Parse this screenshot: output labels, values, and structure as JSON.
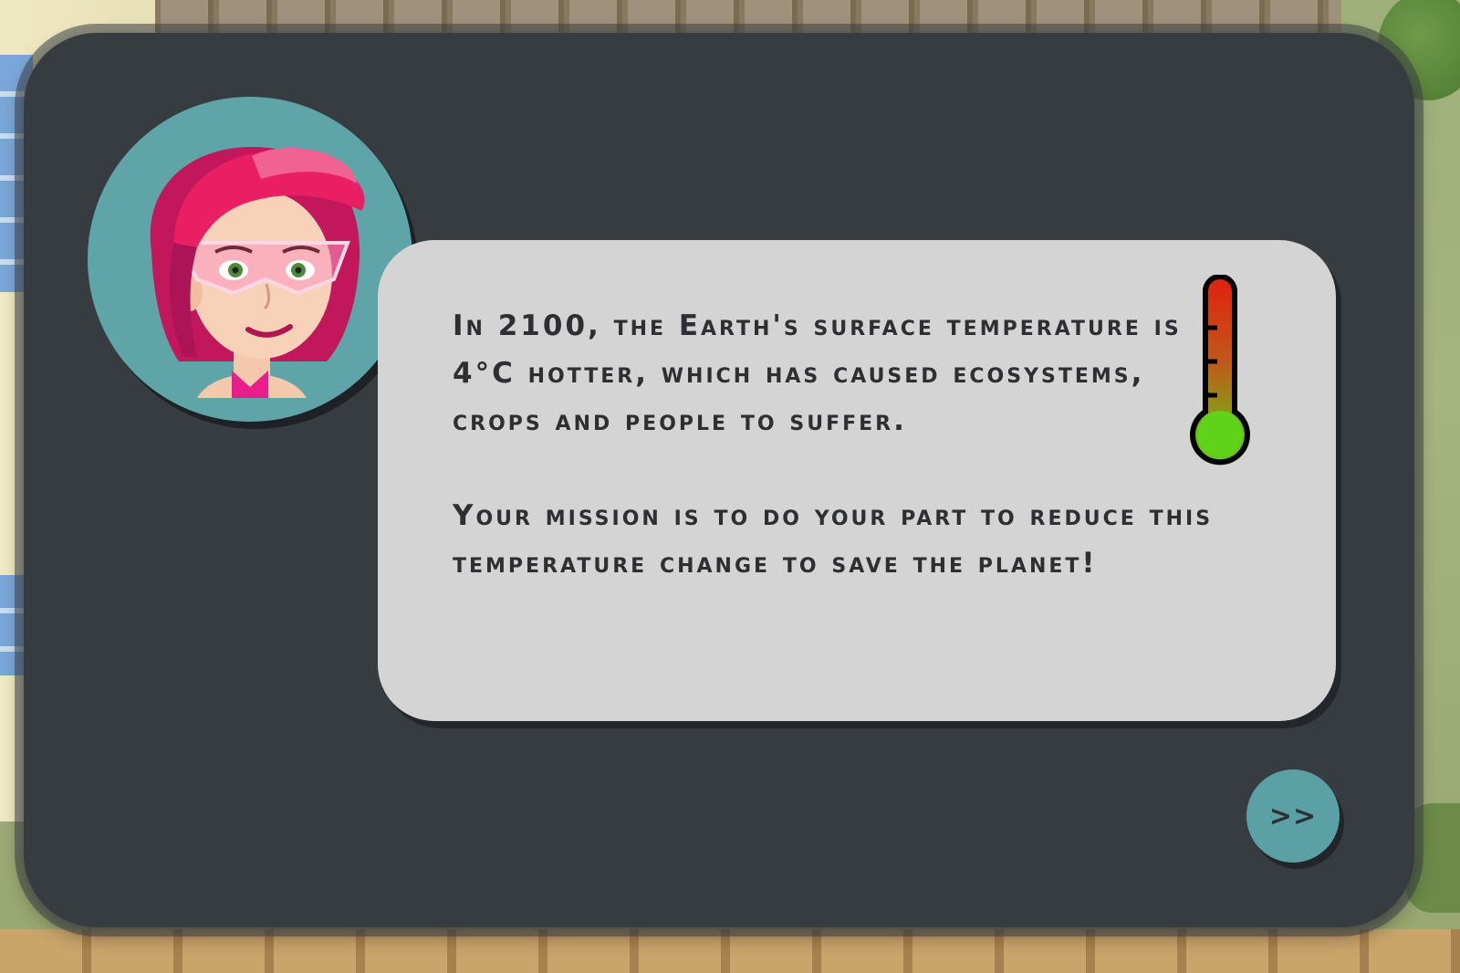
{
  "dialog": {
    "paragraph_1": "In 2100, the Earth's surface temperature is 4°C hotter, which has caused ecosystems, crops and people to suffer.",
    "paragraph_2": "Your mission is to do your part to reduce this temperature change to save the planet!",
    "next_label": ">>"
  },
  "icons": {
    "avatar": "character-portrait-pink-hair",
    "thermometer": "thermometer-icon"
  },
  "colors": {
    "panel": "#373c41",
    "bubble": "#d4d4d4",
    "accent_teal": "#5fa5a8",
    "thermo_hot": "#e0200f",
    "thermo_cool": "#5fd21a"
  }
}
